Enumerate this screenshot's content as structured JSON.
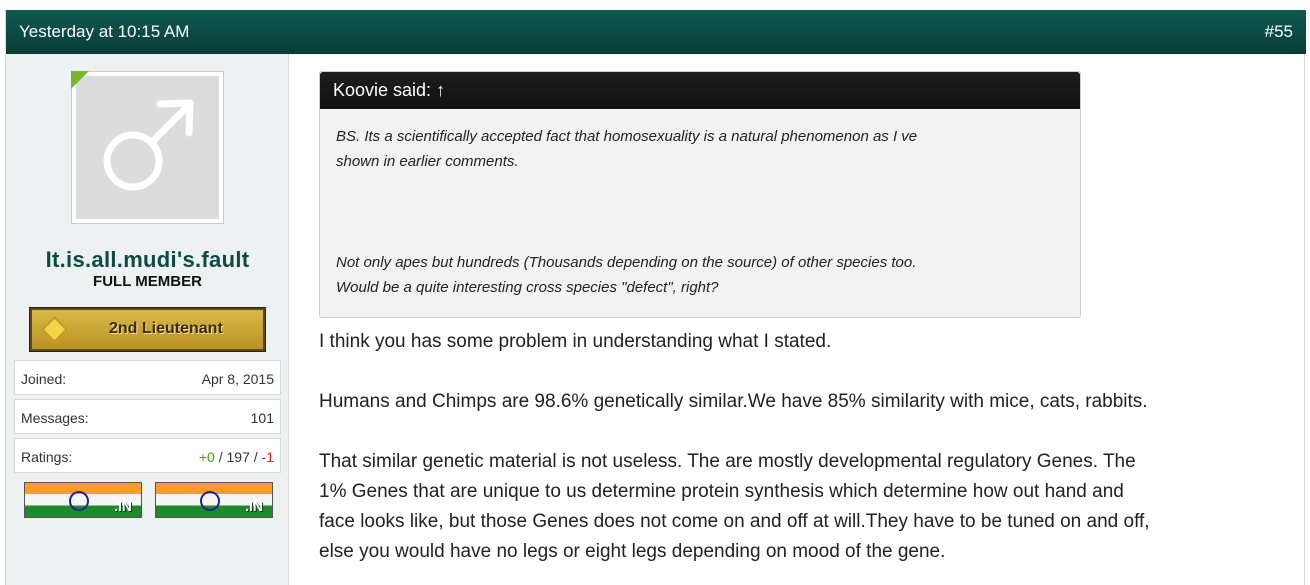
{
  "post": {
    "date": "Yesterday at 10:15 AM",
    "number": "#55"
  },
  "user": {
    "avatar_icon": "male-symbol-icon",
    "name": "It.is.all.mudi's.fault",
    "title": "FULL MEMBER",
    "rank": "2nd Lieutenant",
    "stats": {
      "joined_label": "Joined:",
      "joined_value": "Apr 8, 2015",
      "messages_label": "Messages:",
      "messages_value": "101",
      "ratings_label": "Ratings:",
      "ratings_pos": "+0",
      "ratings_sep1": " / ",
      "ratings_neutral": "197",
      "ratings_sep2": " / ",
      "ratings_neg": "-1"
    },
    "flags": [
      {
        "tld": ".IN"
      },
      {
        "tld": ".IN"
      }
    ]
  },
  "quote": {
    "author_line": "Koovie said: ",
    "arrow": "↑",
    "lines": [
      "BS. Its a scientifically accepted fact that homosexuality is a natural phenomenon as I ve",
      "shown in earlier comments.",
      "Not only apes but hundreds (Thousands depending on the source) of other species too.",
      "Would be a quite interesting cross species \"defect\", right?"
    ]
  },
  "body": {
    "p1": "I think you has some problem in understanding what I stated.",
    "p2": "Humans and Chimps are 98.6% genetically similar.We have 85% similarity with mice, cats, rabbits.",
    "p3_lines": [
      "That similar genetic material is not useless. The are mostly developmental regulatory Genes. The",
      "1% Genes that are unique to us determine protein synthesis which determine how out hand and",
      "face looks like, but those Genes does not come on and off at will.They have to be tuned on and off,",
      "else you would have no legs or eight legs depending on mood of the gene."
    ]
  }
}
